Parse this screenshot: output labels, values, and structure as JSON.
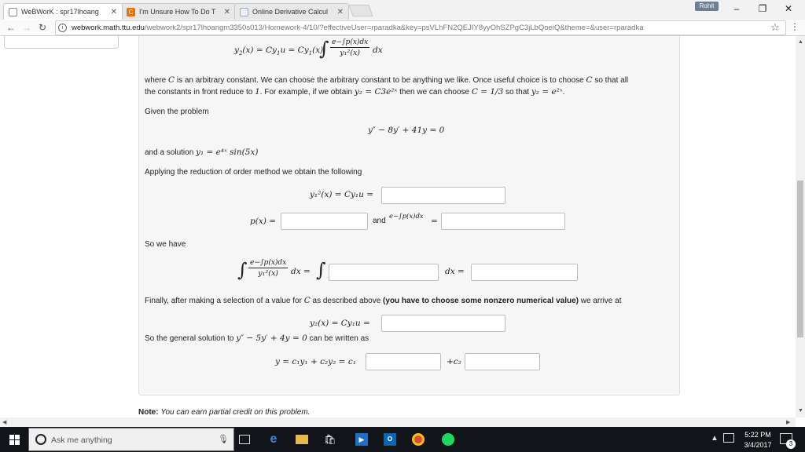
{
  "browser": {
    "tabs": [
      {
        "label": "WeBWorK : spr17lhoang",
        "favicon": "document-icon"
      },
      {
        "label": "I'm Unsure How To Do T",
        "favicon": "chegg-icon"
      },
      {
        "label": "Online Derivative Calcul",
        "favicon": "page-icon"
      }
    ],
    "profile": "Rohit",
    "url_host": "webwork.math.ttu.edu",
    "url_path": "/webwork2/spr17lhoangm3350s013/Homework-4/10/?effectiveUser=rparadka&key=psVLhFN2QEJIY8yyOhSZPgC3jLbQoeiQ&theme=&user=rparadka"
  },
  "problem": {
    "top_formula": {
      "lhs": "y",
      "eq": "(x) = Cy",
      "eq2": "u = Cy",
      "eq3": "(x)",
      "num": "e−∫p(x)dx",
      "den": "y₁²(x)",
      "dx": "dx"
    },
    "para1_a": "where",
    "para1_C": "C",
    "para1_b": "is an arbitrary constant. We can choose the arbitrary constant to be anything we like. Once useful choice is to choose",
    "para1_C2": "C",
    "para1_c": "so that all",
    "para2_a": "the constants in front reduce to",
    "para2_one": "1",
    "para2_b": ". For example, if we obtain",
    "para2_y2": "y₂ = C3e²ˣ",
    "para2_c": "then we can choose",
    "para2_C": "C = 1/3",
    "para2_d": "so that",
    "para2_y2b": "y₂ = e²ˣ",
    "para2_end": ".",
    "given": "Given the problem",
    "ode": "y″ − 8y′ + 41y = 0",
    "solution_label": "and a solution",
    "solution": "y₁ = e⁴ˣ sin(5x)",
    "applying": "Applying the reduction of order method we obtain the following",
    "eq1_lhs": "y₁²(x) = Cy₁u =",
    "p_lhs": "p(x) =",
    "and_label": "and",
    "exp_lhs": "e−∫p(x)dx",
    "exp_eq": "=",
    "so_we_have": "So we have",
    "int_num": "e−∫p(x)dx",
    "int_den": "y₁²(x)",
    "int_dx": "dx =",
    "int_dx2": "dx =",
    "finally_a": "Finally, after making a selection of a value for",
    "finally_C": "C",
    "finally_b": "as described above",
    "finally_bold": "(you have to choose some nonzero numerical value)",
    "finally_c": "we arrive at",
    "y2_lhs": "y₂(x) = Cy₁u =",
    "general_a": "So the general solution to",
    "general_ode": "y″ − 5y′ + 4y = 0",
    "general_b": "can be written as",
    "gen_lhs": "y = c₁y₁ + c₂y₂ = c₁",
    "gen_plus": "+c₂",
    "note_label": "Note:",
    "note_text": "You can earn partial credit on this problem."
  },
  "taskbar": {
    "search_placeholder": "Ask me anything",
    "time": "5:22 PM",
    "date": "3/4/2017",
    "notifications": "3"
  }
}
